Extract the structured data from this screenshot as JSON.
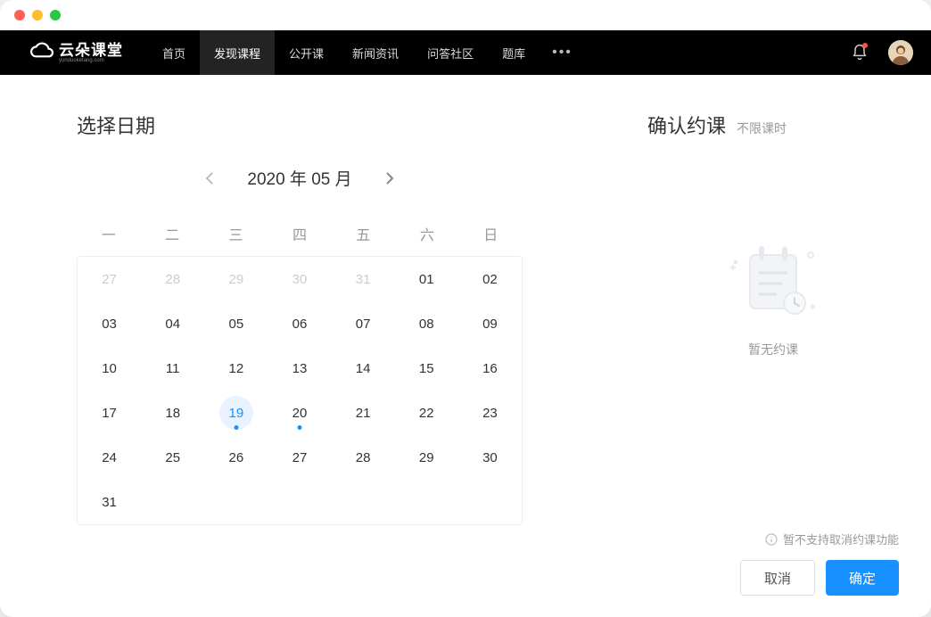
{
  "window": {
    "traffic_lights": [
      "red",
      "yellow",
      "green"
    ]
  },
  "navbar": {
    "logo_text": "云朵课堂",
    "logo_sub": "yunduoketang.com",
    "items": [
      "首页",
      "发现课程",
      "公开课",
      "新闻资讯",
      "问答社区",
      "题库"
    ],
    "active_index": 1
  },
  "left": {
    "title": "选择日期"
  },
  "calendar": {
    "title": "2020 年 05 月",
    "weekdays": [
      "一",
      "二",
      "三",
      "四",
      "五",
      "六",
      "日"
    ],
    "days": [
      {
        "d": "27",
        "other": true
      },
      {
        "d": "28",
        "other": true
      },
      {
        "d": "29",
        "other": true
      },
      {
        "d": "30",
        "other": true
      },
      {
        "d": "31",
        "other": true
      },
      {
        "d": "01"
      },
      {
        "d": "02"
      },
      {
        "d": "03"
      },
      {
        "d": "04"
      },
      {
        "d": "05"
      },
      {
        "d": "06"
      },
      {
        "d": "07"
      },
      {
        "d": "08"
      },
      {
        "d": "09"
      },
      {
        "d": "10"
      },
      {
        "d": "11"
      },
      {
        "d": "12"
      },
      {
        "d": "13"
      },
      {
        "d": "14"
      },
      {
        "d": "15"
      },
      {
        "d": "16"
      },
      {
        "d": "17"
      },
      {
        "d": "18"
      },
      {
        "d": "19",
        "today": true,
        "dot": true
      },
      {
        "d": "20",
        "dot": true
      },
      {
        "d": "21"
      },
      {
        "d": "22"
      },
      {
        "d": "23"
      },
      {
        "d": "24"
      },
      {
        "d": "25"
      },
      {
        "d": "26"
      },
      {
        "d": "27"
      },
      {
        "d": "28"
      },
      {
        "d": "29"
      },
      {
        "d": "30"
      },
      {
        "d": "31"
      }
    ]
  },
  "right": {
    "title": "确认约课",
    "sub": "不限课时",
    "empty_text": "暂无约课",
    "notice": "暂不支持取消约课功能",
    "cancel_label": "取消",
    "confirm_label": "确定"
  },
  "colors": {
    "primary": "#1890ff"
  }
}
